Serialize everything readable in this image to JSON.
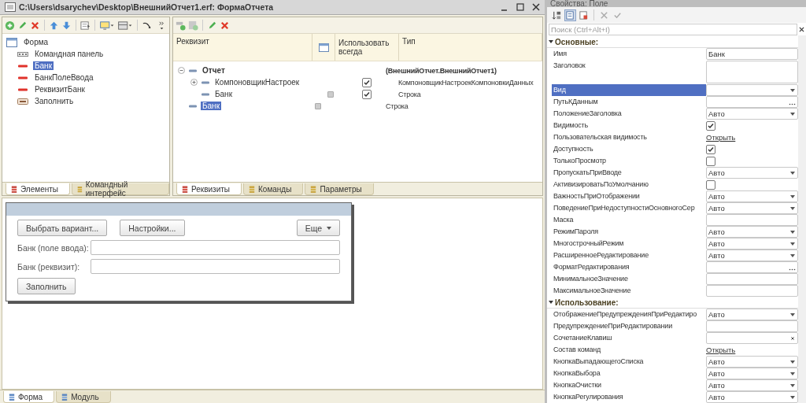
{
  "window": {
    "title": "C:\\Users\\dsarychev\\Desktop\\ВнешнийОтчет1.erf: ФормаОтчета"
  },
  "elements_pane": {
    "tree": [
      {
        "label": "Форма",
        "kind": "form",
        "selected": false,
        "children": [
          {
            "label": "Командная панель",
            "kind": "command_bar",
            "selected": false
          },
          {
            "label": "Банк",
            "kind": "field",
            "selected": true
          },
          {
            "label": "БанкПолеВвода",
            "kind": "field",
            "selected": false
          },
          {
            "label": "РеквизитБанк",
            "kind": "field",
            "selected": false
          },
          {
            "label": "Заполнить",
            "kind": "button",
            "selected": false
          }
        ]
      }
    ],
    "tabs": [
      {
        "label": "Элементы",
        "selected": true
      },
      {
        "label": "Командный интерфейс",
        "selected": false
      }
    ]
  },
  "requisites_pane": {
    "columns": [
      "Реквизит",
      "Использовать всегда",
      "Тип"
    ],
    "rows": [
      {
        "label": "Отчет",
        "type": "(ВнешнийОтчет.ВнешнийОтчет1)",
        "bold": true,
        "expanded": true,
        "selected": false,
        "children": [
          {
            "label": "КомпоновщикНастроек",
            "type": "КомпоновщикНастроекКомпоновкиДанных",
            "bold": false,
            "expanded": false,
            "marker": false,
            "use_always": true,
            "selected": false
          },
          {
            "label": "Банк",
            "type": "Строка",
            "bold": false,
            "marker": true,
            "use_always": true,
            "selected": false
          }
        ]
      },
      {
        "label": "Банк",
        "type": "Строка",
        "bold": false,
        "marker": true,
        "selected": true
      }
    ],
    "tabs": [
      {
        "label": "Реквизиты",
        "selected": true
      },
      {
        "label": "Команды",
        "selected": false
      },
      {
        "label": "Параметры",
        "selected": false
      }
    ]
  },
  "form_preview": {
    "buttons": [
      {
        "label": "Выбрать вариант...",
        "kind": "plain"
      },
      {
        "label": "Настройки...",
        "kind": "plain"
      },
      {
        "label": "Еще",
        "kind": "menu"
      }
    ],
    "fields": [
      {
        "label": "Банк (поле ввода):"
      },
      {
        "label": "Банк (реквизит):"
      }
    ],
    "fill_button": "Заполнить"
  },
  "bottom_tabs": [
    {
      "label": "Форма",
      "selected": true
    },
    {
      "label": "Модуль",
      "selected": false
    }
  ],
  "properties": {
    "title": "Свойства: Поле",
    "search": {
      "placeholder": "Поиск (Ctrl+Alt+I)"
    },
    "sections": [
      {
        "title": "Основные:",
        "expanded": true,
        "rows": [
          {
            "label": "Имя",
            "kind": "text",
            "value": "Банк",
            "selected": false
          },
          {
            "label": "Заголовок",
            "kind": "textarea",
            "selected": false
          },
          {
            "label": "Вид",
            "kind": "select",
            "selected": true
          },
          {
            "label": "ПутьКДанным",
            "kind": "dots",
            "selected": false
          },
          {
            "label": "ПоложениеЗаголовка",
            "kind": "select",
            "value": "Авто",
            "selected": false
          },
          {
            "label": "Видимость",
            "kind": "checkbox",
            "checked": true,
            "selected": false
          },
          {
            "label": "Пользовательская видимость",
            "kind": "link",
            "value": "Открыть",
            "selected": false
          },
          {
            "label": "Доступность",
            "kind": "checkbox",
            "checked": true,
            "selected": false
          },
          {
            "label": "ТолькоПросмотр",
            "kind": "checkbox",
            "checked": false,
            "selected": false
          },
          {
            "label": "ПропускатьПриВводе",
            "kind": "select",
            "value": "Авто",
            "selected": false
          },
          {
            "label": "АктивизироватьПоУмолчанию",
            "kind": "checkbox",
            "checked": false,
            "selected": false
          },
          {
            "label": "ВажностьПриОтображении",
            "kind": "select",
            "value": "Авто",
            "selected": false
          },
          {
            "label": "ПоведениеПриНедоступностиОсновногоСер",
            "kind": "select",
            "value": "Авто",
            "selected": false
          },
          {
            "label": "Маска",
            "kind": "text",
            "selected": false
          },
          {
            "label": "РежимПароля",
            "kind": "select",
            "value": "Авто",
            "selected": false
          },
          {
            "label": "МногострочныйРежим",
            "kind": "select",
            "value": "Авто",
            "selected": false
          },
          {
            "label": "РасширенноеРедактирование",
            "kind": "select",
            "value": "Авто",
            "selected": false
          },
          {
            "label": "ФорматРедактирования",
            "kind": "dots",
            "selected": false
          },
          {
            "label": "МинимальноеЗначение",
            "kind": "text",
            "selected": false
          },
          {
            "label": "МаксимальноеЗначение",
            "kind": "text",
            "selected": false
          }
        ]
      },
      {
        "title": "Использование:",
        "expanded": true,
        "rows": [
          {
            "label": "ОтображениеПредупрежденияПриРедактиро",
            "kind": "select",
            "value": "Авто",
            "selected": false
          },
          {
            "label": "ПредупреждениеПриРедактировании",
            "kind": "text",
            "selected": false
          },
          {
            "label": "СочетаниеКлавиш",
            "kind": "clear",
            "selected": false
          },
          {
            "label": "Состав команд",
            "kind": "link",
            "value": "Открыть",
            "selected": false
          },
          {
            "label": "КнопкаВыпадающегоСписка",
            "kind": "select",
            "value": "Авто",
            "selected": false
          },
          {
            "label": "КнопкаВыбора",
            "kind": "select",
            "value": "Авто",
            "selected": false
          },
          {
            "label": "КнопкаОчистки",
            "kind": "select",
            "value": "Авто",
            "selected": false
          },
          {
            "label": "КнопкаРегулирования",
            "kind": "select",
            "value": "Авто",
            "selected": false
          }
        ]
      }
    ]
  }
}
